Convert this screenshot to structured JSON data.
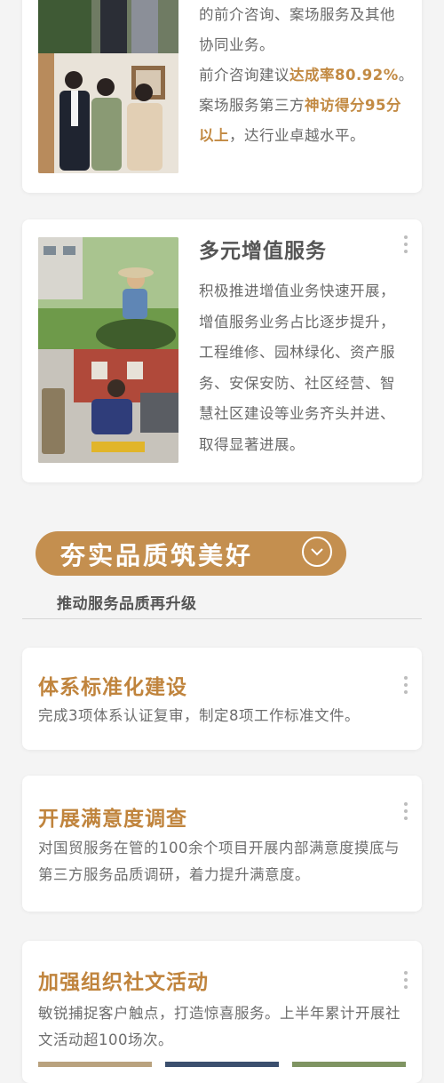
{
  "card1": {
    "text_lines": [
      "的前介咨询、案场服务及其他",
      "协同业务。"
    ],
    "line3_pre": "前介咨询建议",
    "line3_hl": "达成率80.92%",
    "line3_post": "。",
    "line4_pre": "案场服务第三方",
    "line4_hl": "神访得分95分",
    "line5_hl": "以上",
    "line5_post": "，达行业卓越水平。"
  },
  "card2": {
    "title": "多元增值服务",
    "body": "积极推进增值业务快速开展，增值服务业务占比逐步提升，工程维修、园林绿化、资产服务、安保安防、社区经营、智慧社区建设等业务齐头并进、取得显著进展。"
  },
  "section": {
    "title": "夯实品质筑美好",
    "subtitle": "推动服务品质再升级"
  },
  "cards": [
    {
      "title": "体系标准化建设",
      "desc": "完成3项体系认证复审，制定8项工作标准文件。"
    },
    {
      "title": "开展满意度调查",
      "desc": "对国贸服务在管的100余个项目开展内部满意度摸底与第三方服务品质调研，着力提升满意度。"
    },
    {
      "title": "加强组织社文活动",
      "desc": "敏锐捕捉客户触点，打造惊喜服务。上半年累计开展社文活动超100场次。"
    }
  ],
  "colors": {
    "accent": "#c0843d",
    "banner": "#c48f4f",
    "background": "#f4f4f4"
  }
}
